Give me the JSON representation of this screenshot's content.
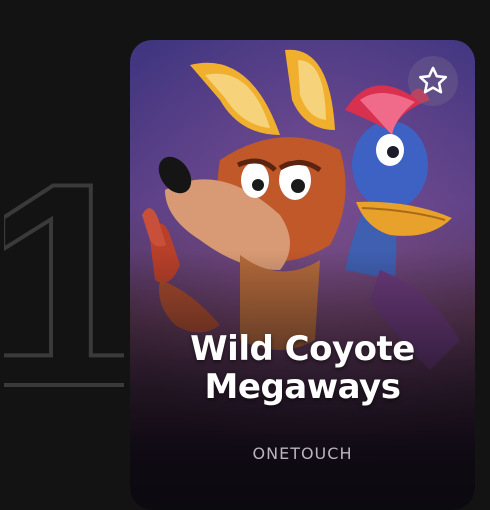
{
  "rank": {
    "number": "1"
  },
  "card": {
    "title_line1": "Wild Coyote",
    "title_line2": "Megaways",
    "provider": "ONETOUCH",
    "favorite_icon": "star-outline-icon",
    "colors": {
      "background": "#131313",
      "rank_outline": "#3a3a3a",
      "art_top": "#4a3b86",
      "art_bottom": "#2a1b2e",
      "provider_text": "#b9b4bd"
    }
  }
}
